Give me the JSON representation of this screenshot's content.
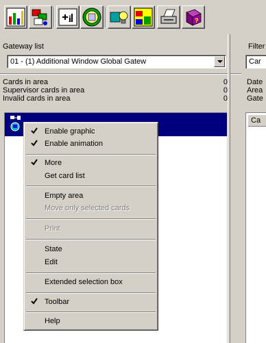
{
  "toolbar": {
    "buttons": [
      {
        "icon": "statistics-icon"
      },
      {
        "icon": "cards-icon"
      },
      {
        "icon": "info-icon"
      },
      {
        "icon": "card-reader-icon"
      },
      {
        "icon": "lightbulb-icon"
      },
      {
        "icon": "map-icon"
      },
      {
        "icon": "printer-icon"
      },
      {
        "icon": "help-book-icon"
      }
    ]
  },
  "left": {
    "gateway_label": "Gateway list",
    "gateway_value": "01 - (1) Additional Window Global Gatew",
    "stats": [
      {
        "label": "Cards in area",
        "value": "0"
      },
      {
        "label": "Supervisor cards in area",
        "value": "0"
      },
      {
        "label": "Invalid cards in area",
        "value": "0"
      }
    ]
  },
  "right": {
    "filter_label": "Filter",
    "combo_value": "Car",
    "info_lines": [
      "Date",
      "Area",
      "Gate"
    ],
    "list_header": "Ca"
  },
  "menu": {
    "items": [
      {
        "label": "Enable graphic",
        "checked": true,
        "enabled": true
      },
      {
        "label": "Enable animation",
        "checked": true,
        "enabled": true
      },
      {
        "label": "More",
        "checked": true,
        "enabled": true
      },
      {
        "label": "Get card list",
        "checked": false,
        "enabled": true
      },
      {
        "label": "Empty area",
        "checked": false,
        "enabled": true
      },
      {
        "label": "Move only selected cards",
        "checked": false,
        "enabled": false
      },
      {
        "label": "Print",
        "checked": false,
        "enabled": false
      },
      {
        "label": "State",
        "checked": false,
        "enabled": true
      },
      {
        "label": "Edit",
        "checked": false,
        "enabled": true
      },
      {
        "label": "Extended selection box",
        "checked": false,
        "enabled": true
      },
      {
        "label": "Toolbar",
        "checked": true,
        "enabled": true
      },
      {
        "label": "Help",
        "checked": false,
        "enabled": true
      }
    ]
  },
  "colors": {
    "face": "#d4d0c8",
    "selection": "#00007f",
    "disabled_text": "#808080"
  }
}
